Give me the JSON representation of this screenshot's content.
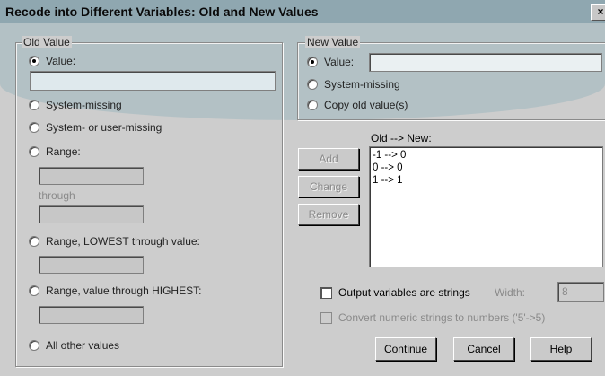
{
  "window": {
    "title": "Recode into Different Variables: Old and New Values",
    "close_label": "×"
  },
  "old_value": {
    "legend": "Old Value",
    "value_radio": "Value:",
    "value_input": "",
    "system_missing": "System-missing",
    "system_or_user_missing": "System- or user-missing",
    "range": "Range:",
    "range_from": "",
    "through": "through",
    "range_to": "",
    "range_lowest": "Range, LOWEST through value:",
    "range_lowest_input": "",
    "range_highest": "Range, value through HIGHEST:",
    "range_highest_input": "",
    "all_other": "All other values",
    "selected": "value"
  },
  "new_value": {
    "legend": "New Value",
    "value_radio": "Value:",
    "value_input": "",
    "system_missing": "System-missing",
    "copy_old": "Copy old value(s)",
    "selected": "value"
  },
  "old_new": {
    "label": "Old --> New:",
    "items": [
      "-1 --> 0",
      "0 --> 0",
      "1 --> 1"
    ]
  },
  "buttons": {
    "add": "Add",
    "change": "Change",
    "remove": "Remove",
    "continue": "Continue",
    "cancel": "Cancel",
    "help": "Help"
  },
  "options": {
    "output_strings": "Output variables are strings",
    "width_label": "Width:",
    "width_value": "8",
    "convert_numeric": "Convert numeric strings to numbers ('5'->5)"
  }
}
